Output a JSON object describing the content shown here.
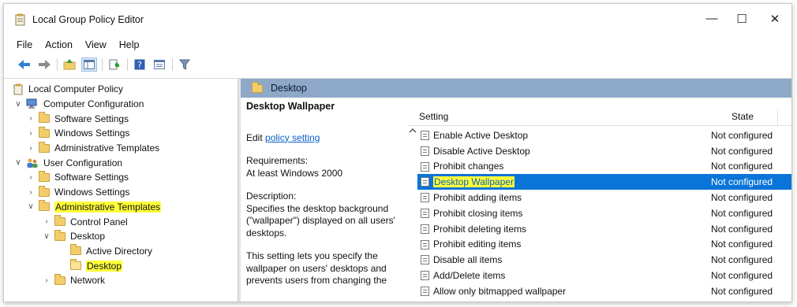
{
  "window": {
    "title": "Local Group Policy Editor",
    "minimize": "—",
    "maximize": "☐",
    "close": "✕"
  },
  "menu": [
    "File",
    "Action",
    "View",
    "Help"
  ],
  "tree": {
    "root": "Local Computer Policy",
    "computer_config": "Computer Configuration",
    "cc_software": "Software Settings",
    "cc_windows": "Windows Settings",
    "cc_admin": "Administrative Templates",
    "user_config": "User Configuration",
    "uc_software": "Software Settings",
    "uc_windows": "Windows Settings",
    "uc_admin": "Administrative Templates",
    "control_panel": "Control Panel",
    "desktop": "Desktop",
    "active_directory": "Active Directory",
    "desktop_child": "Desktop",
    "network": "Network"
  },
  "path": "Desktop",
  "description": {
    "title": "Desktop Wallpaper",
    "edit_prefix": "Edit ",
    "edit_link": "policy setting",
    "requirements_label": "Requirements:",
    "requirements_value": "At least Windows 2000",
    "description_label": "Description:",
    "description_text": "Specifies the desktop background (\"wallpaper\") displayed on all users' desktops.",
    "more_text": "This setting lets you specify the wallpaper on users' desktops and prevents users from changing the"
  },
  "settings": {
    "col_setting": "Setting",
    "col_state": "State",
    "rows": [
      {
        "name": "Enable Active Desktop",
        "state": "Not configured"
      },
      {
        "name": "Disable Active Desktop",
        "state": "Not configured"
      },
      {
        "name": "Prohibit changes",
        "state": "Not configured"
      },
      {
        "name": "Desktop Wallpaper",
        "state": "Not configured"
      },
      {
        "name": "Prohibit adding items",
        "state": "Not configured"
      },
      {
        "name": "Prohibit closing items",
        "state": "Not configured"
      },
      {
        "name": "Prohibit deleting items",
        "state": "Not configured"
      },
      {
        "name": "Prohibit editing items",
        "state": "Not configured"
      },
      {
        "name": "Disable all items",
        "state": "Not configured"
      },
      {
        "name": "Add/Delete items",
        "state": "Not configured"
      },
      {
        "name": "Allow only bitmapped wallpaper",
        "state": "Not configured"
      }
    ]
  },
  "colors": {
    "selection": "#0a74d8",
    "highlight": "#ffff3a",
    "path_bar": "#8ea9c8",
    "link": "#0b5ec7"
  }
}
